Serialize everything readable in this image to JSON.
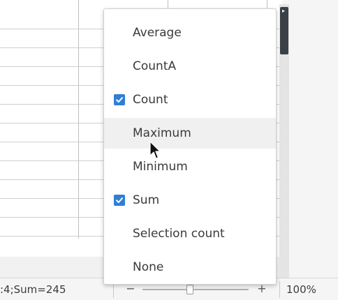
{
  "menu": {
    "items": [
      {
        "label": "Average",
        "checked": false,
        "hover": false
      },
      {
        "label": "CountA",
        "checked": false,
        "hover": false
      },
      {
        "label": "Count",
        "checked": true,
        "hover": false
      },
      {
        "label": "Maximum",
        "checked": false,
        "hover": true
      },
      {
        "label": "Minimum",
        "checked": false,
        "hover": false
      },
      {
        "label": "Sum",
        "checked": true,
        "hover": false
      },
      {
        "label": "Selection count",
        "checked": false,
        "hover": false
      },
      {
        "label": "None",
        "checked": false,
        "hover": false
      }
    ]
  },
  "statusbar": {
    "formula": ":4;Sum=245",
    "zoom_minus": "−",
    "zoom_plus": "+",
    "zoom_level": 0.45,
    "zoom_percent": "100%"
  },
  "colors": {
    "checkbox": "#2f7fd7",
    "scroll_thumb": "#3b4046",
    "menu_hover": "#f0f0f0"
  },
  "icons": {
    "check": "check-icon",
    "cursor": "mouse-pointer-icon",
    "scroll_arrow": "triangle-right-icon"
  }
}
